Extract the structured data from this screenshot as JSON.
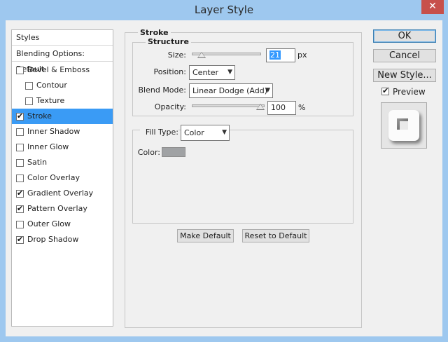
{
  "window": {
    "title": "Layer Style",
    "close_glyph": "✕"
  },
  "styles_list": {
    "header": "Styles",
    "blending": "Blending Options: Default",
    "items": [
      {
        "label": "Bevel & Emboss",
        "checked": false
      },
      {
        "label": "Contour",
        "checked": false,
        "indent": true
      },
      {
        "label": "Texture",
        "checked": false,
        "indent": true
      },
      {
        "label": "Stroke",
        "checked": true,
        "selected": true
      },
      {
        "label": "Inner Shadow",
        "checked": false
      },
      {
        "label": "Inner Glow",
        "checked": false
      },
      {
        "label": "Satin",
        "checked": false
      },
      {
        "label": "Color Overlay",
        "checked": false
      },
      {
        "label": "Gradient Overlay",
        "checked": true
      },
      {
        "label": "Pattern Overlay",
        "checked": true
      },
      {
        "label": "Outer Glow",
        "checked": false
      },
      {
        "label": "Drop Shadow",
        "checked": true
      }
    ]
  },
  "stroke": {
    "title": "Stroke",
    "structure": {
      "title": "Structure",
      "size_label": "Size:",
      "size_value": "21",
      "size_unit": "px",
      "position_label": "Position:",
      "position_value": "Center",
      "blend_label": "Blend Mode:",
      "blend_value": "Linear Dodge (Add)",
      "opacity_label": "Opacity:",
      "opacity_value": "100",
      "opacity_unit": "%"
    },
    "fill": {
      "fill_type_label": "Fill Type:",
      "fill_type_value": "Color",
      "color_label": "Color:",
      "color_hex": "#a0a2a4"
    },
    "make_default": "Make Default",
    "reset_default": "Reset to Default"
  },
  "actions": {
    "ok": "OK",
    "cancel": "Cancel",
    "new_style": "New Style...",
    "preview_label": "Preview",
    "preview_checked": true,
    "check_glyph": "✔"
  },
  "colors": {
    "accent_selection": "#3a9bf5",
    "titlebar": "#9ec8ef",
    "close_button": "#c7504b"
  }
}
